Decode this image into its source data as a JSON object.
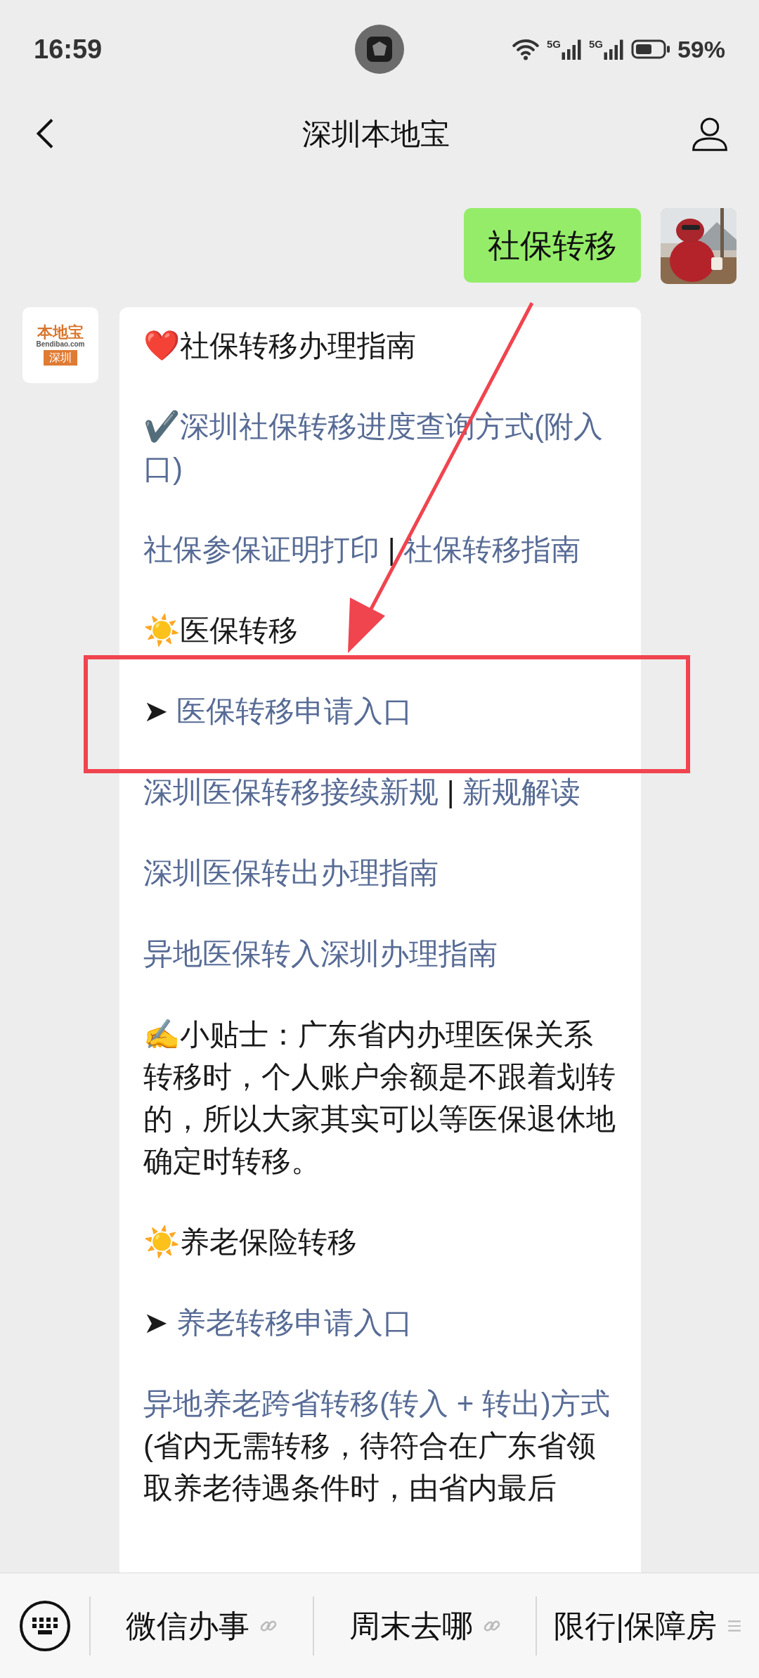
{
  "status_bar": {
    "time": "16:59",
    "network_1": "5G",
    "network_2": "5G",
    "battery": "59%"
  },
  "nav": {
    "title": "深圳本地宝"
  },
  "messages": [
    {
      "kind": "sent",
      "text": "社保转移"
    },
    {
      "kind": "article",
      "avatar": {
        "brand": "本地宝",
        "domain": "Bendibao.com",
        "city": "深圳"
      },
      "paragraphs": [
        {
          "kind": "stacked",
          "segments": [
            {
              "kind": "text",
              "text": "❤️社保转移办理指南"
            }
          ]
        },
        {
          "kind": "stacked",
          "segments": [
            {
              "kind": "link",
              "text": "✔️深圳社保转移进度查询方式(附入口)"
            }
          ]
        },
        {
          "kind": "inline",
          "segments": [
            {
              "kind": "link",
              "text": "社保参保证明打印"
            },
            {
              "kind": "text",
              "text": " | "
            },
            {
              "kind": "link",
              "text": "社保转移指南"
            }
          ]
        },
        {
          "kind": "stacked",
          "segments": [
            {
              "kind": "text",
              "text": "☀️医保转移"
            }
          ]
        },
        {
          "kind": "inline",
          "segments": [
            {
              "kind": "text",
              "text": "➤ "
            },
            {
              "kind": "link",
              "text": "医保转移申请入口"
            }
          ]
        },
        {
          "kind": "inline",
          "segments": [
            {
              "kind": "link",
              "text": "深圳医保转移接续新规"
            },
            {
              "kind": "text",
              "text": " | "
            },
            {
              "kind": "link",
              "text": "新规解读"
            }
          ]
        },
        {
          "kind": "stacked",
          "segments": [
            {
              "kind": "link",
              "text": "深圳医保转出办理指南"
            }
          ]
        },
        {
          "kind": "stacked",
          "segments": [
            {
              "kind": "link",
              "text": "异地医保转入深圳办理指南"
            }
          ]
        },
        {
          "kind": "stacked",
          "segments": [
            {
              "kind": "text",
              "text": "✍️小贴士：广东省内办理医保关系转移时，个人账户余额是不跟着划转的，所以大家其实可以等医保退休地确定时转移。"
            }
          ]
        },
        {
          "kind": "stacked",
          "segments": [
            {
              "kind": "text",
              "text": "☀️养老保险转移"
            }
          ]
        },
        {
          "kind": "inline",
          "segments": [
            {
              "kind": "text",
              "text": "➤ "
            },
            {
              "kind": "link",
              "text": "养老转移申请入口"
            }
          ]
        },
        {
          "kind": "stacked",
          "segments": [
            {
              "kind": "link",
              "text": "异地养老跨省转移(转入 + 转出)方式"
            },
            {
              "kind": "text",
              "text": "(省内无需转移，待符合在广东省领取养老待遇条件时，由省内最后"
            }
          ]
        }
      ]
    }
  ],
  "menu": [
    {
      "kind": "link",
      "label": "微信办事"
    },
    {
      "kind": "link",
      "label": "周末去哪"
    },
    {
      "kind": "submenu",
      "label": "限行|保障房"
    }
  ]
}
